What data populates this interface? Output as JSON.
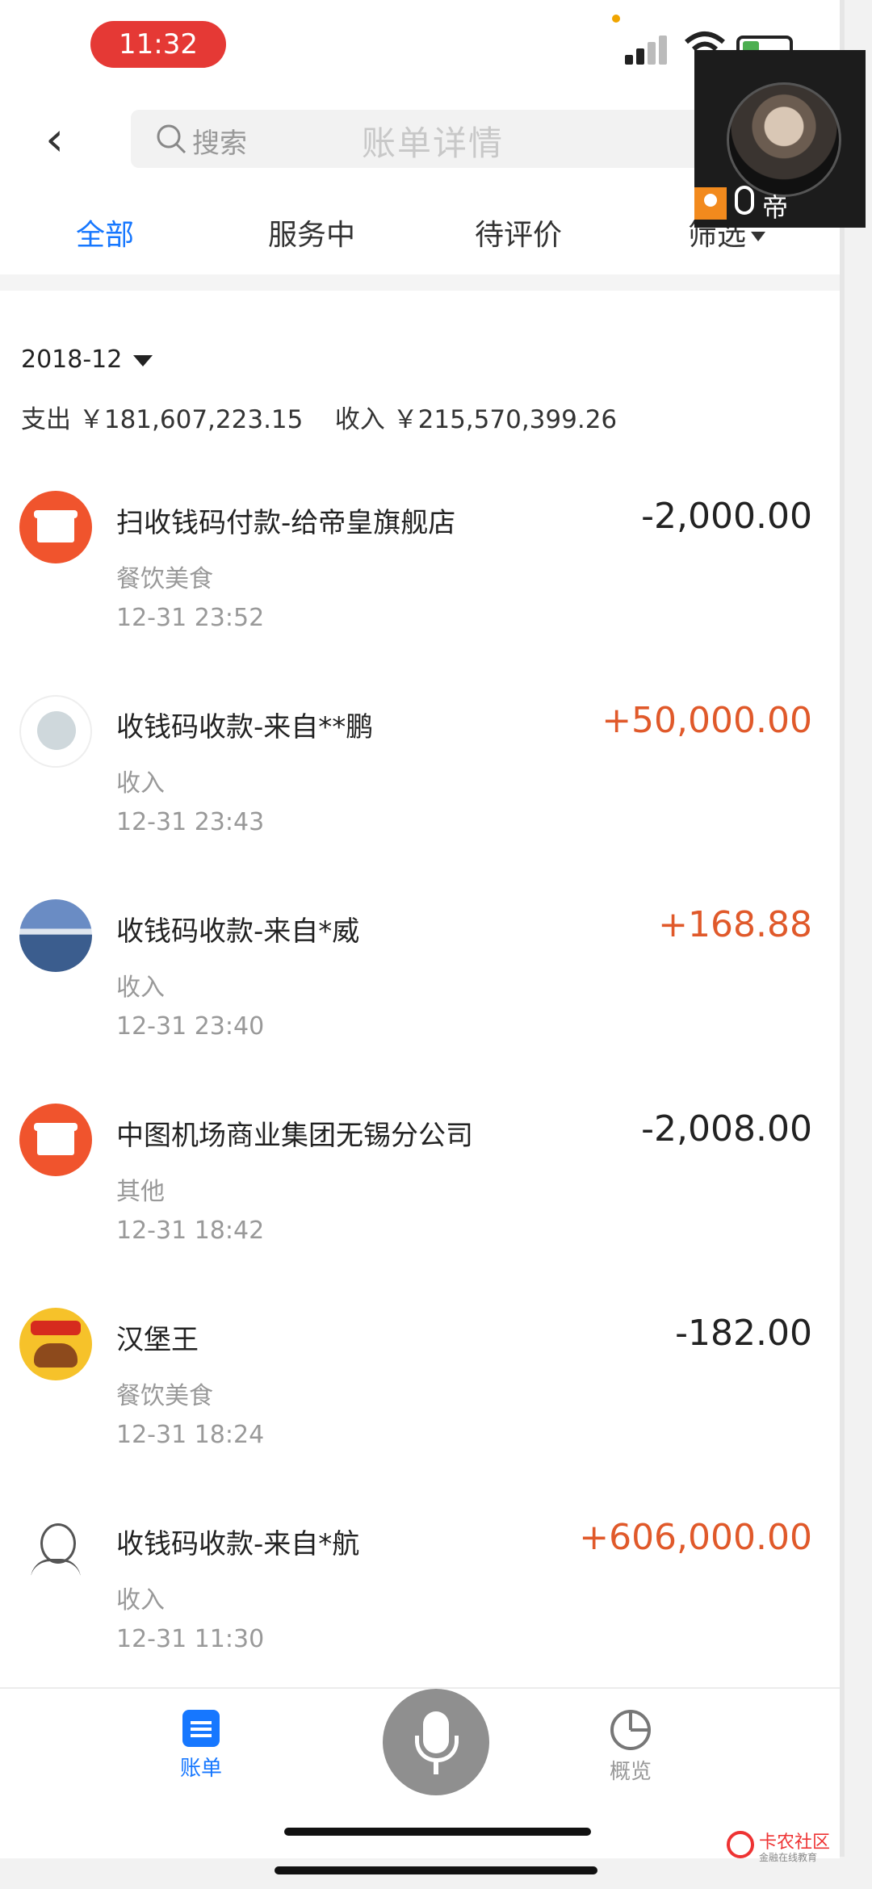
{
  "status_bar": {
    "time": "11:32"
  },
  "header": {
    "back_icon": "chevron-left-icon",
    "search_placeholder": "搜索",
    "title": "账单详情"
  },
  "tabs": [
    {
      "label": "全部",
      "active": true
    },
    {
      "label": "服务中",
      "active": false
    },
    {
      "label": "待评价",
      "active": false
    },
    {
      "label": "筛选",
      "active": false
    }
  ],
  "overlay": {
    "name": "帝"
  },
  "summary": {
    "month": "2018-12",
    "text": "支出 ￥181,607,223.15    收入 ￥215,570,399.26"
  },
  "transactions": [
    {
      "title": "扫收钱码付款-给帝皇旗舰店",
      "category": "餐饮美食",
      "time": "12-31  23:52",
      "amount": "-2,000.00",
      "icon": "shop-icon"
    },
    {
      "title": "收钱码收款-来自**鹏",
      "category": "收入",
      "time": "12-31  23:43",
      "amount": "+50,000.00",
      "icon": "sticker-avatar-icon"
    },
    {
      "title": "收钱码收款-来自*威",
      "category": "收入",
      "time": "12-31  23:40",
      "amount": "+168.88",
      "icon": "lake-avatar-icon"
    },
    {
      "title": "中图机场商业集团无锡分公司",
      "category": "其他",
      "time": "12-31  18:42",
      "amount": "-2,008.00",
      "icon": "shop-icon"
    },
    {
      "title": "汉堡王",
      "category": "餐饮美食",
      "time": "12-31  18:24",
      "amount": "-182.00",
      "icon": "burger-icon"
    },
    {
      "title": "收钱码收款-来自*航",
      "category": "收入",
      "time": "12-31  11:30",
      "amount": "+606,000.00",
      "icon": "portrait-avatar-icon"
    }
  ],
  "bottom_nav": {
    "bill": "账单",
    "overview": "概览"
  },
  "watermark": {
    "name": "卡农社区",
    "slogan": "金融在线教育"
  },
  "colors": {
    "accent": "#1677ff",
    "income": "#e0592a",
    "time_pill": "#e53935",
    "shop_icon": "#f0542d"
  }
}
